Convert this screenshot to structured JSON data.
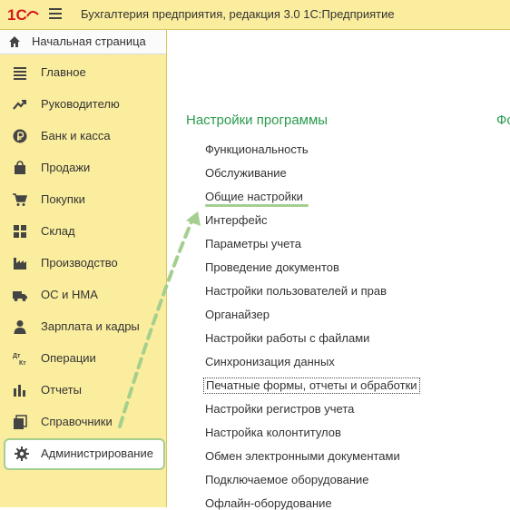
{
  "app": {
    "title": "Бухгалтерия предприятия, редакция 3.0 1С:Предприятие",
    "logo_text": "1С"
  },
  "colors": {
    "sidebar_bg": "#fbed9e",
    "accent_green": "#2a9b4e",
    "highlight_green": "#a4cf8e",
    "logo_red": "#d6191b"
  },
  "sidebar": {
    "home_label": "Начальная страница",
    "items": [
      {
        "label": "Главное",
        "icon": "list-icon"
      },
      {
        "label": "Руководителю",
        "icon": "trend-icon"
      },
      {
        "label": "Банк и касса",
        "icon": "ruble-icon"
      },
      {
        "label": "Продажи",
        "icon": "bag-icon"
      },
      {
        "label": "Покупки",
        "icon": "cart-icon"
      },
      {
        "label": "Склад",
        "icon": "boxes-icon"
      },
      {
        "label": "Производство",
        "icon": "factory-icon"
      },
      {
        "label": "ОС и НМА",
        "icon": "truck-icon"
      },
      {
        "label": "Зарплата и кадры",
        "icon": "person-icon"
      },
      {
        "label": "Операции",
        "icon": "dt-kt-icon"
      },
      {
        "label": "Отчеты",
        "icon": "bar-chart-icon"
      },
      {
        "label": "Справочники",
        "icon": "books-icon"
      },
      {
        "label": "Администрирование",
        "icon": "gear-icon",
        "active": true
      }
    ]
  },
  "main": {
    "section_title": "Настройки программы",
    "section_title_2": "Фо",
    "links": [
      "Функциональность",
      "Обслуживание",
      "Общие настройки",
      "Интерфейс",
      "Параметры учета",
      "Проведение документов",
      "Настройки пользователей и прав",
      "Органайзер",
      "Настройки работы с файлами",
      "Синхронизация данных",
      "Печатные формы, отчеты и обработки",
      "Настройки регистров учета",
      "Настройка колонтитулов",
      "Обмен электронными документами",
      "Подключаемое оборудование",
      "Офлайн-оборудование"
    ],
    "highlighted_link": "Общие настройки",
    "focused_link": "Печатные формы, отчеты и обработки"
  }
}
